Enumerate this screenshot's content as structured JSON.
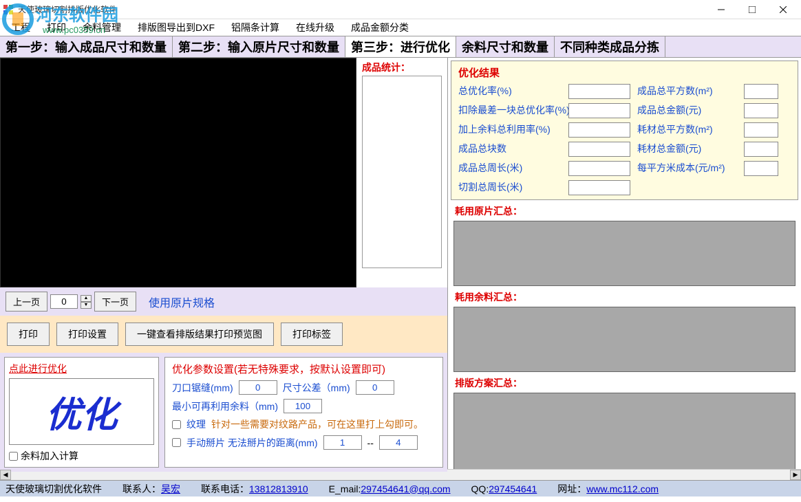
{
  "titlebar": {
    "title": "天使玻璃切割排版优化软件"
  },
  "menubar": {
    "items": [
      "工程",
      "打印",
      "余料管理",
      "排版图导出到DXF",
      "铝隔条计算",
      "在线升级",
      "成品金额分类"
    ]
  },
  "watermark": {
    "brand": "河东软件园",
    "url": "www.pc0359.cn"
  },
  "tabs": {
    "items": [
      "第一步：输入成品尺寸和数量",
      "第二步：输入原片尺寸和数量",
      "第三步：进行优化",
      "余料尺寸和数量",
      "不同种类成品分拣"
    ],
    "active_index": 2
  },
  "stats": {
    "label": "成品统计："
  },
  "pager": {
    "prev": "上一页",
    "value": "0",
    "next": "下一页",
    "spec": "使用原片规格"
  },
  "print": {
    "print": "打印",
    "settings": "打印设置",
    "preview": "一键查看排版结果打印预览图",
    "labels": "打印标签"
  },
  "optimize": {
    "link": "点此进行优化",
    "big": "优化",
    "chk_remainder": "余料加入计算"
  },
  "params": {
    "title": "优化参数设置(若无特殊要求，按默认设置即可)",
    "kerf_label": "刀口锯缝(mm)",
    "kerf_value": "0",
    "tol_label": "尺寸公差（mm)",
    "tol_value": "0",
    "min_label": "最小可再利用余料（mm)",
    "min_value": "100",
    "texture_label": "纹理",
    "texture_note": "针对一些需要对纹路产品，可在这里打上勾即可。",
    "manual_label": "手动掰片 无法掰片的距离(mm)",
    "manual_v1": "1",
    "manual_sep": "--",
    "manual_v2": "4"
  },
  "results": {
    "title": "优化结果",
    "rows": [
      {
        "l": "总优化率(%)",
        "r": "成品总平方数(m²)"
      },
      {
        "l": "扣除最差一块总优化率(%)",
        "r": "成品总金额(元)"
      },
      {
        "l": "加上余料总利用率(%)",
        "r": "耗材总平方数(m²)"
      },
      {
        "l": "成品总块数",
        "r": "耗材总金额(元)"
      },
      {
        "l": "成品总周长(米)",
        "r": "每平方米成本(元/m²)"
      },
      {
        "l": "切割总周长(米)",
        "r": ""
      }
    ]
  },
  "sections": {
    "s1": "耗用原片汇总：",
    "s2": "耗用余料汇总：",
    "s3": "排版方案汇总："
  },
  "statusbar": {
    "product": "天使玻璃切割优化软件",
    "contact_label": "联系人：",
    "contact": "吴宏",
    "phone_label": "联系电话：",
    "phone": "13812813910",
    "email_label": "E_mail:",
    "email": "297454641@qq.com",
    "qq_label": "QQ:",
    "qq": "297454641",
    "web_label": "网址：",
    "web": "www.mc112.com"
  }
}
